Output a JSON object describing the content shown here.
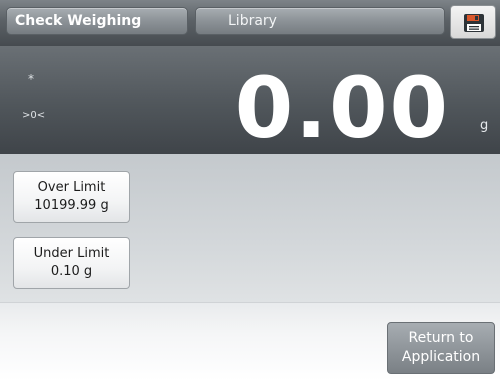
{
  "header": {
    "app_title": "Check Weighing",
    "library_label": "Library",
    "save_icon": "floppy-disk-icon"
  },
  "display": {
    "stable_indicator": "*",
    "center_zero_indicator": ">0<",
    "weight_value": "0.00",
    "unit": "g"
  },
  "limits": {
    "over": {
      "label": "Over Limit",
      "value": "10199.99 g"
    },
    "under": {
      "label": "Under Limit",
      "value": "0.10 g"
    }
  },
  "footer": {
    "return_line1": "Return to",
    "return_line2": "Application"
  },
  "colors": {
    "header_bg": "#5b6166",
    "display_bg": "#50565b",
    "panel_bg": "#d3d7da",
    "save_icon_accent": "#d9572b"
  }
}
